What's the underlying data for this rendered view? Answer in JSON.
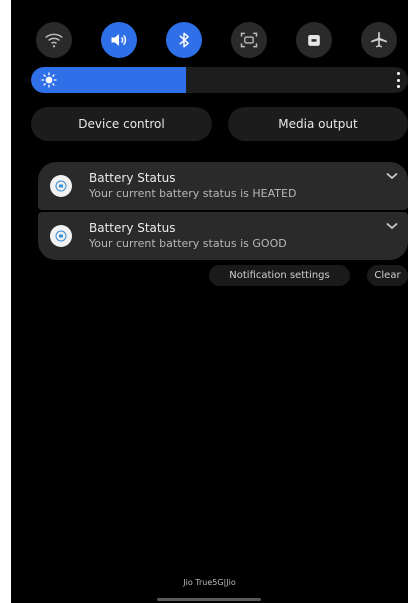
{
  "quick_settings": {
    "tiles": [
      {
        "id": "wifi",
        "icon": "wifi-icon",
        "active": false
      },
      {
        "id": "sound",
        "icon": "volume-icon",
        "active": true
      },
      {
        "id": "bluetooth",
        "icon": "bluetooth-icon",
        "active": true
      },
      {
        "id": "screenshot",
        "icon": "screen-capture-icon",
        "active": false
      },
      {
        "id": "lock",
        "icon": "lock-icon",
        "active": false
      },
      {
        "id": "airplane",
        "icon": "airplane-icon",
        "active": false
      }
    ],
    "brightness_level": 0.41,
    "accent_color": "#2f6fe8"
  },
  "controls": {
    "device_control": "Device control",
    "media_output": "Media output"
  },
  "notifications": [
    {
      "title": "Battery Status",
      "text": "Your current battery status is HEATED"
    },
    {
      "title": "Battery Status",
      "text": "Your current battery status is GOOD"
    }
  ],
  "actions": {
    "notification_settings": "Notification settings",
    "clear": "Clear"
  },
  "carrier": "Jio True5G|Jio"
}
